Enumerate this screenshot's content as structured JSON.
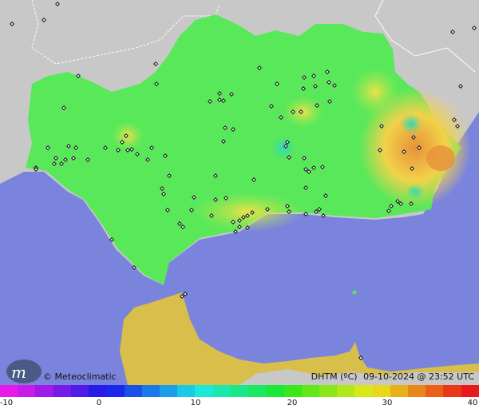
{
  "map": {
    "title": "",
    "variable": "DHTM (ºC)",
    "timestamp": "09-10-2024 @ 23:52 UTC",
    "credit": "© Meteoclimatic",
    "logo_text": "m",
    "colors": {
      "sea": "#7b84dc",
      "land_outside": "#c8c8c8",
      "land_base": "#59e85a",
      "africa": "#d8be4a",
      "warm": "#f2e04a",
      "hot": "#e8a23a",
      "cool": "#3fe09a",
      "station": "#111111"
    },
    "station_icon": "diamond-station-icon"
  },
  "legend": {
    "min": -10,
    "max": 40,
    "ticks": [
      "-10",
      "0",
      "10",
      "20",
      "30",
      "40"
    ],
    "colors": [
      "#e81ae8",
      "#c81ae8",
      "#a01ae8",
      "#781ae8",
      "#501ae8",
      "#281ae8",
      "#1a28e8",
      "#1a50e8",
      "#1a78e8",
      "#1aa0e8",
      "#1ac8e8",
      "#1ae8d8",
      "#1ae8b0",
      "#1ae888",
      "#1ae860",
      "#1ae838",
      "#38e81a",
      "#60e81a",
      "#88e81a",
      "#b0e81a",
      "#d8e81a",
      "#e8d81a",
      "#e8b01a",
      "#e8881a",
      "#e8601a",
      "#e8381a",
      "#e81a1a"
    ]
  }
}
